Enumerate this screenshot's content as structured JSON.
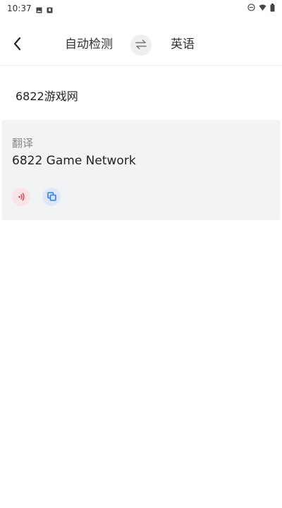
{
  "status_bar": {
    "time": "10:37",
    "icons_left": [
      "image-icon",
      "download-icon"
    ],
    "icons_right": [
      "dnd-icon",
      "wifi-icon",
      "battery-icon"
    ]
  },
  "header": {
    "source_language": "自动检测",
    "target_language": "英语",
    "icons": [
      "back-arrow-icon",
      "swap-arrows-icon"
    ]
  },
  "source": {
    "text": "6822游戏网"
  },
  "result": {
    "label": "翻译",
    "text": "6822 Game Network",
    "actions": [
      {
        "name": "speak",
        "icon": "speaker-icon",
        "color": "#e53950",
        "bg": "#fbe3e6"
      },
      {
        "name": "copy",
        "icon": "copy-icon",
        "color": "#2f7df6",
        "bg": "#dde8fb"
      }
    ]
  }
}
